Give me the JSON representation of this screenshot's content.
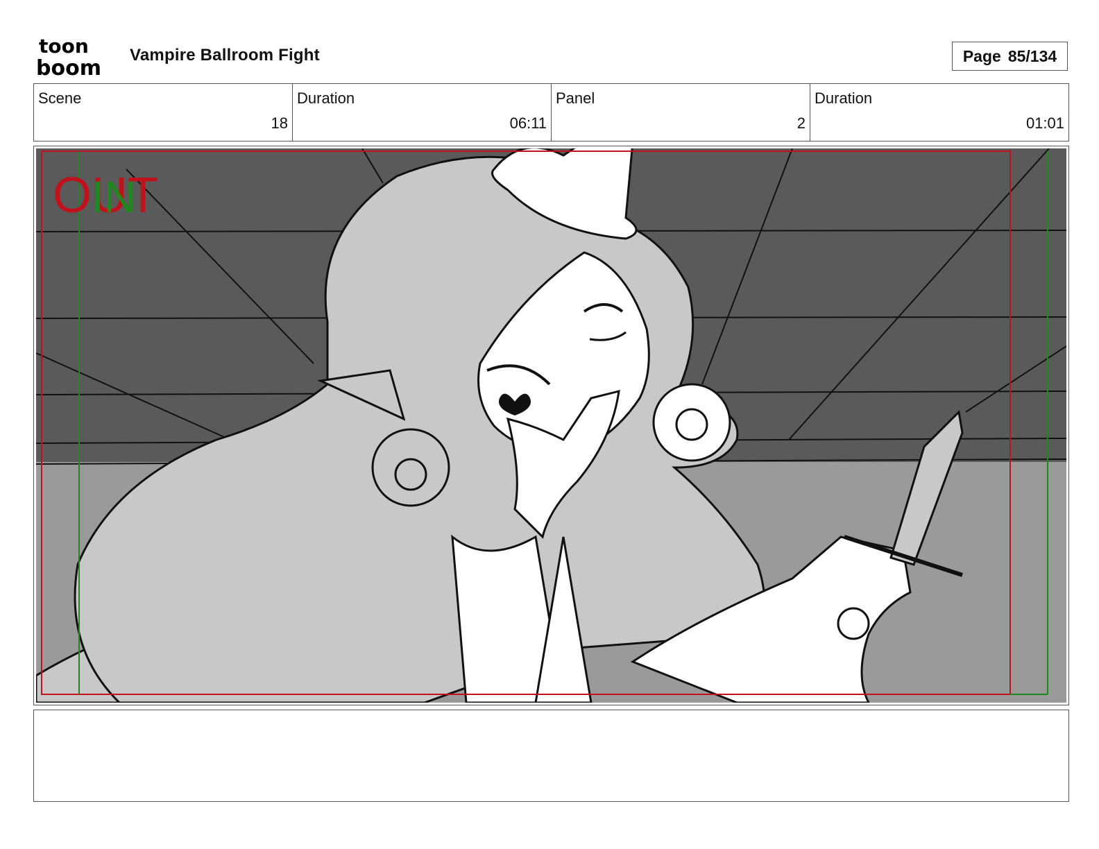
{
  "header": {
    "logo_text_top": "toon",
    "logo_text_bottom": "boom",
    "project_title": "Vampire Ballroom Fight",
    "page_label": "Page",
    "page_value": "85/134"
  },
  "info": [
    {
      "label": "Scene",
      "value": "18"
    },
    {
      "label": "Duration",
      "value": "06:11"
    },
    {
      "label": "Panel",
      "value": "2"
    },
    {
      "label": "Duration",
      "value": "01:01"
    }
  ],
  "panel": {
    "overlay_out": "OUT",
    "overlay_in": "IN",
    "colors": {
      "out_frame": "#c0121c",
      "in_frame": "#1e8a1e",
      "ceiling": "#5a5a5a",
      "wall": "#9a9a9a",
      "hair": "#c8c8c8",
      "line": "#111111"
    }
  },
  "notes": {
    "text": ""
  }
}
